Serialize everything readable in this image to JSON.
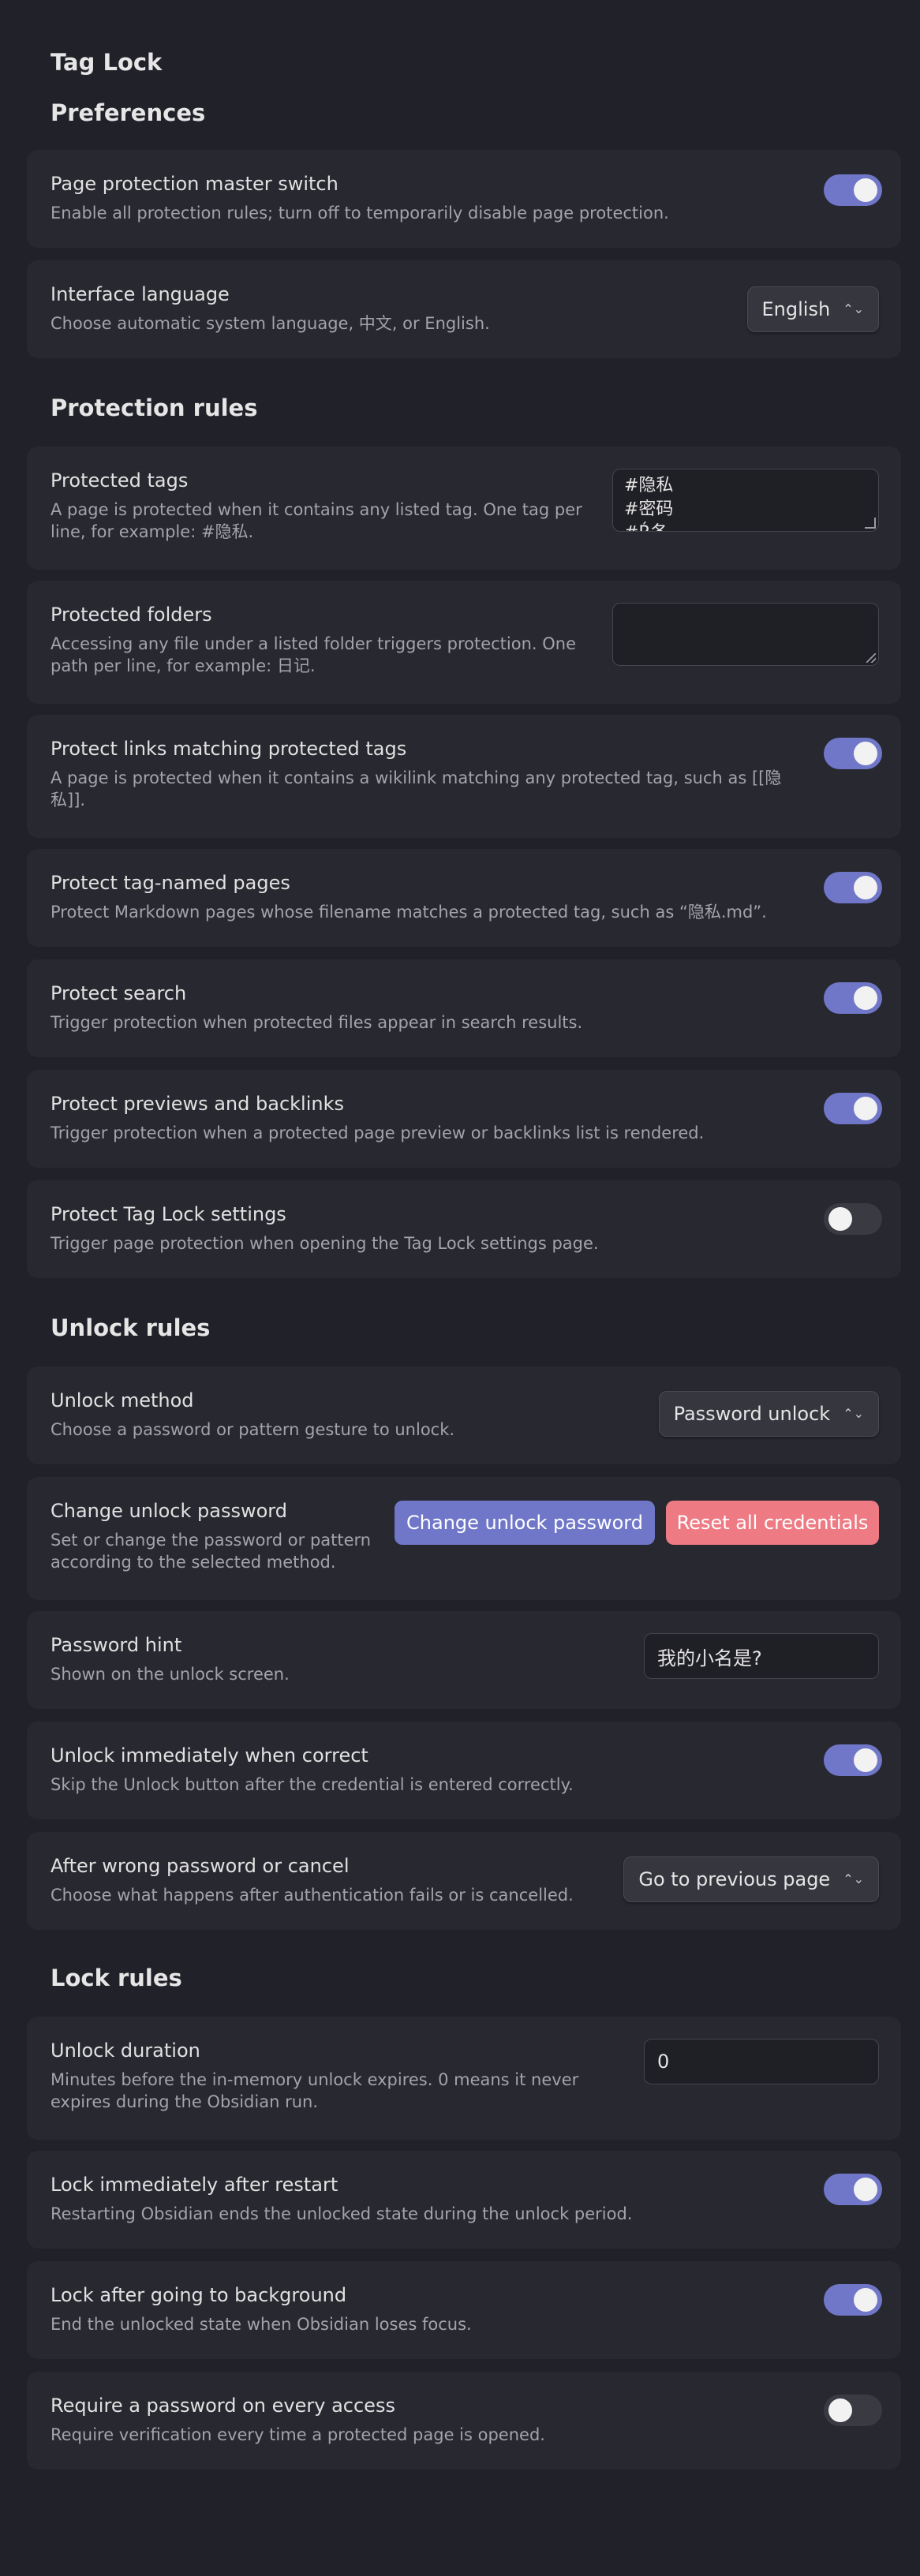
{
  "plugin_title": "Tag Lock",
  "sections": {
    "preferences": "Preferences",
    "protection_rules": "Protection rules",
    "unlock_rules": "Unlock rules",
    "lock_rules": "Lock rules"
  },
  "settings": {
    "master_switch": {
      "name": "Page protection master switch",
      "desc": "Enable all protection rules; turn off to temporarily disable page protection.",
      "enabled": true
    },
    "interface_language": {
      "name": "Interface language",
      "desc": "Choose automatic system language, 中文, or English.",
      "value": "English"
    },
    "protected_tags": {
      "name": "Protected tags",
      "desc": "A page is protected when it contains any listed tag. One tag per line, for example: #隐私.",
      "lines": [
        "#隐私",
        "#密码",
        "#Ŕ各"
      ]
    },
    "protected_folders": {
      "name": "Protected folders",
      "desc": "Accessing any file under a listed folder triggers protection. One path per line, for example: 日记.",
      "value": ""
    },
    "protect_links": {
      "name": "Protect links matching protected tags",
      "desc": "A page is protected when it contains a wikilink matching any protected tag, such as [[隐私]].",
      "enabled": true
    },
    "protect_tag_named_pages": {
      "name": "Protect tag-named pages",
      "desc": "Protect Markdown pages whose filename matches a protected tag, such as “隐私.md”.",
      "enabled": true
    },
    "protect_search": {
      "name": "Protect search",
      "desc": "Trigger protection when protected files appear in search results.",
      "enabled": true
    },
    "protect_previews": {
      "name": "Protect previews and backlinks",
      "desc": "Trigger protection when a protected page preview or backlinks list is rendered.",
      "enabled": true
    },
    "protect_settings": {
      "name": "Protect Tag Lock settings",
      "desc": "Trigger page protection when opening the Tag Lock settings page.",
      "enabled": false
    },
    "unlock_method": {
      "name": "Unlock method",
      "desc": "Choose a password or pattern gesture to unlock.",
      "value": "Password unlock"
    },
    "change_password": {
      "name": "Change unlock password",
      "desc": "Set or change the password or pattern according to the selected method.",
      "change_label": "Change unlock password",
      "reset_label": "Reset all credentials"
    },
    "password_hint": {
      "name": "Password hint",
      "desc": "Shown on the unlock screen.",
      "value": "我的小名是?"
    },
    "unlock_immediately": {
      "name": "Unlock immediately when correct",
      "desc": "Skip the Unlock button after the credential is entered correctly.",
      "enabled": true
    },
    "after_wrong_password": {
      "name": "After wrong password or cancel",
      "desc": "Choose what happens after authentication fails or is cancelled.",
      "value": "Go to previous page"
    },
    "unlock_duration": {
      "name": "Unlock duration",
      "desc": "Minutes before the in-memory unlock expires. 0 means it never expires during the Obsidian run.",
      "value": "0"
    },
    "lock_after_restart": {
      "name": "Lock immediately after restart",
      "desc": "Restarting Obsidian ends the unlocked state during the unlock period.",
      "enabled": true
    },
    "lock_after_background": {
      "name": "Lock after going to background",
      "desc": "End the unlocked state when Obsidian loses focus.",
      "enabled": true
    },
    "require_every_access": {
      "name": "Require a password on every access",
      "desc": "Require verification every time a protected page is opened.",
      "enabled": false
    }
  },
  "icons": {
    "select_chevron": "chevron-up-down-icon",
    "resize_grip": "resize-handle-icon"
  },
  "colors": {
    "background": "#212129",
    "card": "#282830",
    "accent": "#7077c8",
    "danger": "#ee7a84",
    "toggle_off": "#3a3a43"
  }
}
